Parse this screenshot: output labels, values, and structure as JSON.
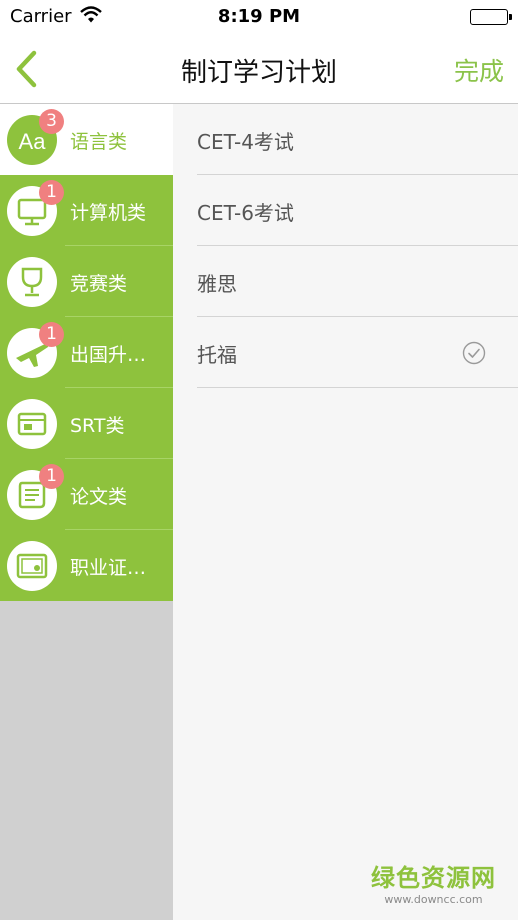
{
  "status_bar": {
    "carrier": "Carrier",
    "time": "8:19 PM"
  },
  "nav": {
    "title": "制订学习计划",
    "done_label": "完成"
  },
  "colors": {
    "accent": "#8ec23d",
    "badge": "#f08080"
  },
  "categories": [
    {
      "label": "语言类",
      "badge": "3",
      "icon": "language-aa-icon",
      "active": true
    },
    {
      "label": "计算机类",
      "badge": "1",
      "icon": "monitor-icon",
      "active": false
    },
    {
      "label": "竞赛类",
      "badge": "",
      "icon": "trophy-icon",
      "active": false
    },
    {
      "label": "出国升…",
      "badge": "1",
      "icon": "airplane-icon",
      "active": false
    },
    {
      "label": "SRT类",
      "badge": "",
      "icon": "folder-icon",
      "active": false
    },
    {
      "label": "论文类",
      "badge": "1",
      "icon": "scroll-icon",
      "active": false
    },
    {
      "label": "职业证…",
      "badge": "",
      "icon": "certificate-icon",
      "active": false
    }
  ],
  "items": [
    {
      "label": "CET-4考试",
      "checked": false
    },
    {
      "label": "CET-6考试",
      "checked": false
    },
    {
      "label": "雅思",
      "checked": false
    },
    {
      "label": "托福",
      "checked": true
    }
  ],
  "watermark": {
    "name": "绿色资源网",
    "url": "www.downcc.com"
  }
}
